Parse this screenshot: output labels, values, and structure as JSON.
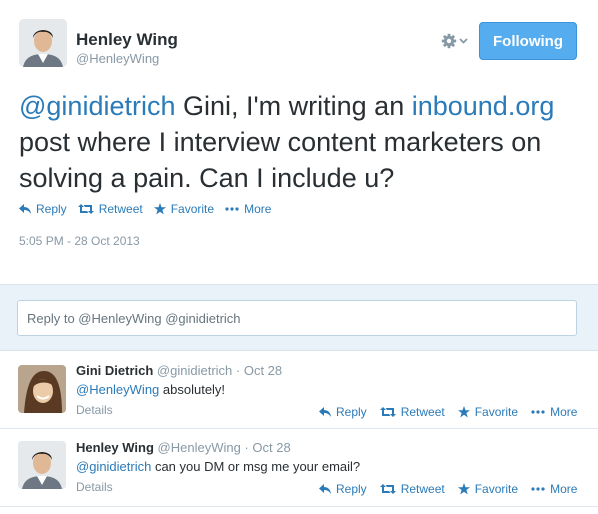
{
  "tweet": {
    "author": {
      "name": "Henley Wing",
      "handle": "@HenleyWing"
    },
    "follow_label": "Following",
    "text": {
      "mention": "@ginidietrich",
      "part1": " Gini, I'm writing an ",
      "link": "inbound.org",
      "part2": " post where I interview content marketers on solving a pain. Can I include u?"
    },
    "actions": {
      "reply": "Reply",
      "retweet": "Retweet",
      "favorite": "Favorite",
      "more": "More"
    },
    "timestamp": "5:05 PM - 28 Oct 2013"
  },
  "reply_box": {
    "placeholder": "Reply to @HenleyWing @ginidietrich"
  },
  "replies": [
    {
      "name": "Gini Dietrich",
      "handle": "@ginidietrich",
      "separator": " · ",
      "date": "Oct 28",
      "mention": "@HenleyWing",
      "text": " absolutely!",
      "details": "Details",
      "actions": {
        "reply": "Reply",
        "retweet": "Retweet",
        "favorite": "Favorite",
        "more": "More"
      }
    },
    {
      "name": "Henley Wing",
      "handle": "@HenleyWing",
      "separator": " · ",
      "date": "Oct 28",
      "mention": "@ginidietrich",
      "text": " can you DM or msg me your email?",
      "details": "Details",
      "actions": {
        "reply": "Reply",
        "retweet": "Retweet",
        "favorite": "Favorite",
        "more": "More"
      }
    }
  ],
  "colors": {
    "link": "#2b7bb9",
    "follow_button": "#55acee",
    "meta": "#8899a6",
    "reply_area_bg": "#e9f2f8"
  },
  "icons": [
    "settings-gear-icon",
    "chevron-down-icon",
    "reply-arrow-icon",
    "retweet-icon",
    "star-icon",
    "more-dots-icon"
  ]
}
